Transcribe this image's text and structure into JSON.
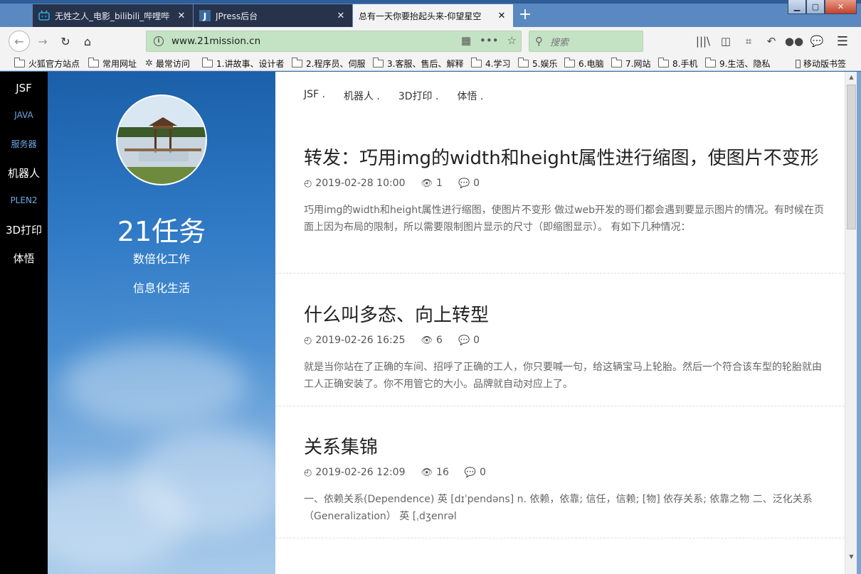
{
  "browser": {
    "tabs": [
      {
        "title": "无姓之人_电影_bilibili_哔哩哔",
        "active": false
      },
      {
        "title": "JPress后台",
        "active": false
      },
      {
        "title": "总有一天你要抬起头来-仰望星空",
        "active": true
      }
    ],
    "url": "www.21mission.cn",
    "search_placeholder": "搜索",
    "bookmarks": [
      "火狐官方站点",
      "常用网址",
      "最常访问",
      "1.讲故事、设计者",
      "2.程序员、伺服",
      "3.客服、售后、解释",
      "4.学习",
      "5.娱乐",
      "6.电脑",
      "7.网站",
      "8.手机",
      "9.生活、隐私",
      "移动版书签"
    ],
    "colors": {
      "urlbar": "#c4e2c4",
      "tab_dark": "#27324b"
    }
  },
  "leftnav": [
    "JSF",
    "JAVA",
    "服务器",
    "机器人",
    "PLEN2",
    "3D打印",
    "体悟"
  ],
  "hero": {
    "title": "21任务",
    "tagline1": "数倍化工作",
    "tagline2": "信息化生活"
  },
  "topnav": [
    "JSF .",
    "机器人 .",
    "3D打印 .",
    "体悟 ."
  ],
  "posts": [
    {
      "title": "转发：巧用img的width和height属性进行缩图，使图片不变形",
      "date": "2019-02-28 10:00",
      "views": "1",
      "comments": "0",
      "excerpt": "巧用img的width和height属性进行缩图，使图片不变形 做过web开发的哥们都会遇到要显示图片的情况。有时候在页面上因为布局的限制，所以需要限制图片显示的尺寸（即缩图显示）。 有如下几种情况："
    },
    {
      "title": "什么叫多态、向上转型",
      "date": "2019-02-26 16:25",
      "views": "6",
      "comments": "0",
      "excerpt": "就是当你站在了正确的车间、招呼了正确的工人，你只要喊一句，给这辆宝马上轮胎。然后一个符合该车型的轮胎就由工人正确安装了。你不用管它的大小。品牌就自动对应上了。"
    },
    {
      "title": "关系集锦",
      "date": "2019-02-26 12:09",
      "views": "16",
      "comments": "0",
      "excerpt": "一、依赖关系(Dependence) 英 [dɪˈpendəns] n. 依赖，依靠; 信任，信赖; [物] 依存关系; 依靠之物 二、泛化关系（Generalization） 英 [ˌdʒenrəl"
    }
  ]
}
